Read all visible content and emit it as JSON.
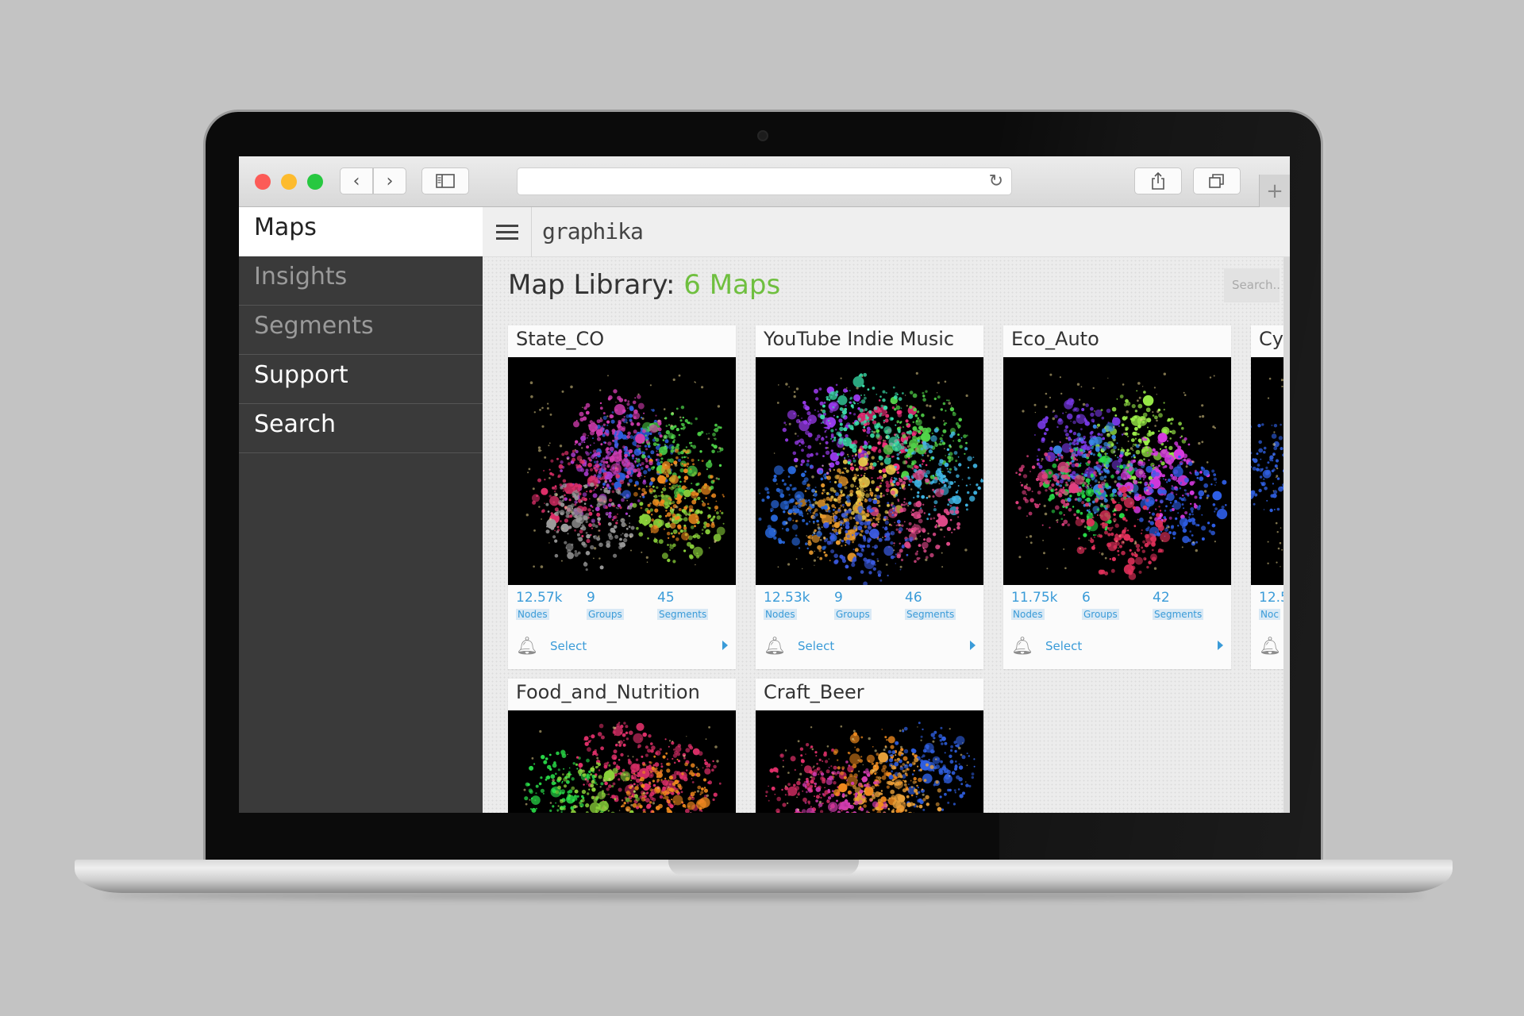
{
  "browser": {
    "back_icon": "‹",
    "forward_icon": "›",
    "reload_icon": "↻",
    "plus_icon": "+"
  },
  "sidebar": {
    "items": [
      {
        "label": "Maps"
      },
      {
        "label": "Insights"
      },
      {
        "label": "Segments"
      },
      {
        "label": "Support"
      },
      {
        "label": "Search"
      }
    ]
  },
  "header": {
    "logo": "graphika"
  },
  "library": {
    "title_prefix": "Map Library:",
    "title_count": "6 Maps",
    "search_placeholder": "Search..."
  },
  "cards": [
    {
      "title": "State_CO",
      "nodes": "12.57k",
      "groups": "9",
      "segments": "45"
    },
    {
      "title": "YouTube Indie Music",
      "nodes": "12.53k",
      "groups": "9",
      "segments": "46"
    },
    {
      "title": "Eco_Auto",
      "nodes": "11.75k",
      "groups": "6",
      "segments": "42"
    },
    {
      "title": "Cy",
      "nodes": "12.5",
      "groups": "",
      "segments": ""
    },
    {
      "title": "Food_and_Nutrition"
    },
    {
      "title": "Craft_Beer"
    }
  ],
  "labels": {
    "nodes": "Nodes",
    "nodes_cut": "Noc",
    "groups": "Groups",
    "segments": "Segments",
    "select": "Select"
  },
  "colors": {
    "accent_blue": "#3a9bd8",
    "count_green": "#6fbf3f"
  }
}
